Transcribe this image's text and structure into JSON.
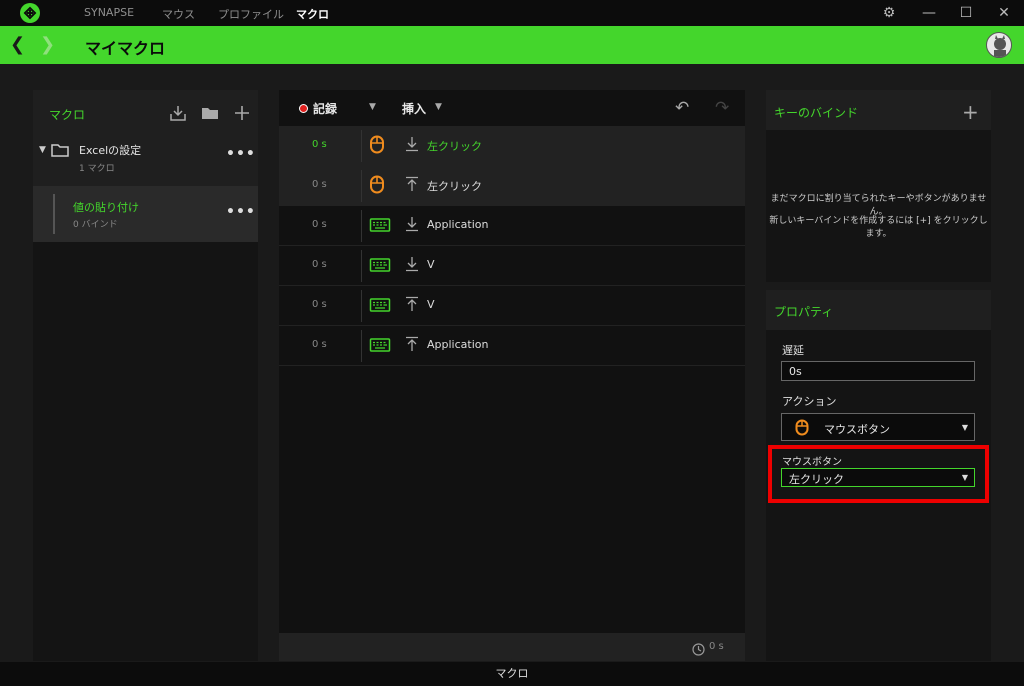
{
  "nav": {
    "tabs": [
      "SYNAPSE",
      "マウス",
      "プロファイル",
      "マクロ"
    ],
    "active_tab": "マクロ"
  },
  "header": {
    "title": "マイマクロ"
  },
  "macros_panel": {
    "title": "マクロ",
    "folder": {
      "name": "Excelの設定",
      "count": "1 マクロ",
      "menu": "•••"
    },
    "item": {
      "name": "値の貼り付け",
      "binds": "0 バインド",
      "menu": "•••"
    }
  },
  "editor": {
    "record_label": "記録",
    "insert_label": "挿入",
    "rows": [
      {
        "time": "0 s",
        "icon": "mouse-icon",
        "dir": "down-arrow-icon",
        "action": "左クリック"
      },
      {
        "time": "0 s",
        "icon": "mouse-icon",
        "dir": "up-arrow-icon",
        "action": "左クリック"
      },
      {
        "time": "0 s",
        "icon": "keyboard-icon",
        "dir": "down-arrow-icon",
        "action": "Application"
      },
      {
        "time": "0 s",
        "icon": "keyboard-icon",
        "dir": "down-arrow-icon",
        "action": "V"
      },
      {
        "time": "0 s",
        "icon": "keyboard-icon",
        "dir": "up-arrow-icon",
        "action": "V"
      },
      {
        "time": "0 s",
        "icon": "keyboard-icon",
        "dir": "up-arrow-icon",
        "action": "Application"
      }
    ],
    "total_time": "0 s"
  },
  "keybind_panel": {
    "title": "キーのバインド",
    "empty_line1": "まだマクロに割り当てられたキーやボタンがありません。",
    "empty_line2": "新しいキーバインドを作成するには [+] をクリックします。"
  },
  "properties": {
    "title": "プロパティ",
    "delay_label": "遅延",
    "delay_value": "0s",
    "action_label": "アクション",
    "action_value": "マウスボタン",
    "mouse_button_label": "マウスボタン",
    "mouse_button_value": "左クリック"
  },
  "footer": {
    "label": "マクロ"
  },
  "colors": {
    "accent": "#44d62c",
    "highlight": "#ee0000",
    "mouse_icon": "#f08c1e"
  }
}
